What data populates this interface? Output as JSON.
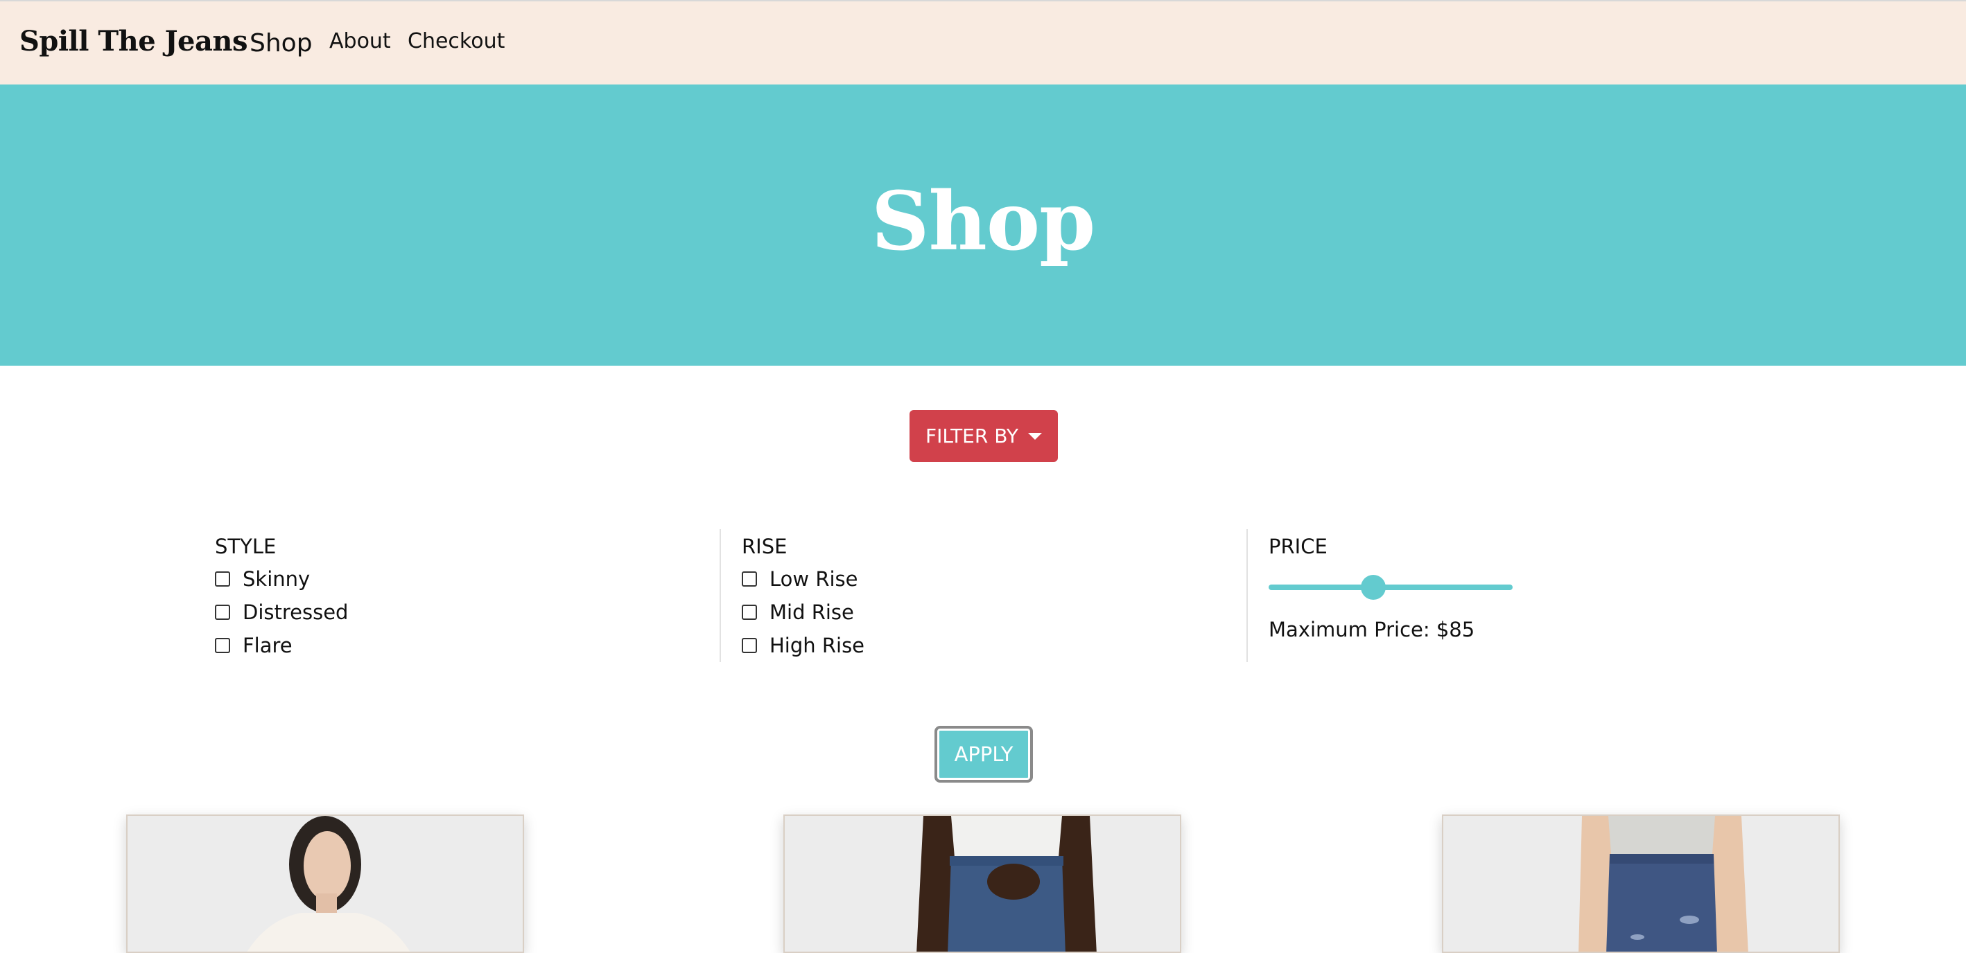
{
  "navbar": {
    "brand": "Spill The Jeans",
    "links": [
      {
        "label": "Shop"
      },
      {
        "label": "About"
      },
      {
        "label": "Checkout"
      }
    ]
  },
  "hero": {
    "title": "Shop"
  },
  "filter": {
    "button_label": "FILTER BY",
    "style": {
      "title": "STYLE",
      "options": [
        "Skinny",
        "Distressed",
        "Flare"
      ]
    },
    "rise": {
      "title": "RISE",
      "options": [
        "Low Rise",
        "Mid Rise",
        "High Rise"
      ]
    },
    "price": {
      "title": "PRICE",
      "max_label": "Maximum Price: $85",
      "slider_level": 0.43
    },
    "apply_label": "APPLY"
  },
  "products": [
    {
      "image": "model-white-sweater-photo"
    },
    {
      "image": "model-jeans-pocket-photo"
    },
    {
      "image": "model-distressed-jeans-photo"
    }
  ],
  "colors": {
    "navbar_bg": "#f9ebe1",
    "accent_teal": "#63cbcf",
    "filter_red": "#d1414b"
  }
}
